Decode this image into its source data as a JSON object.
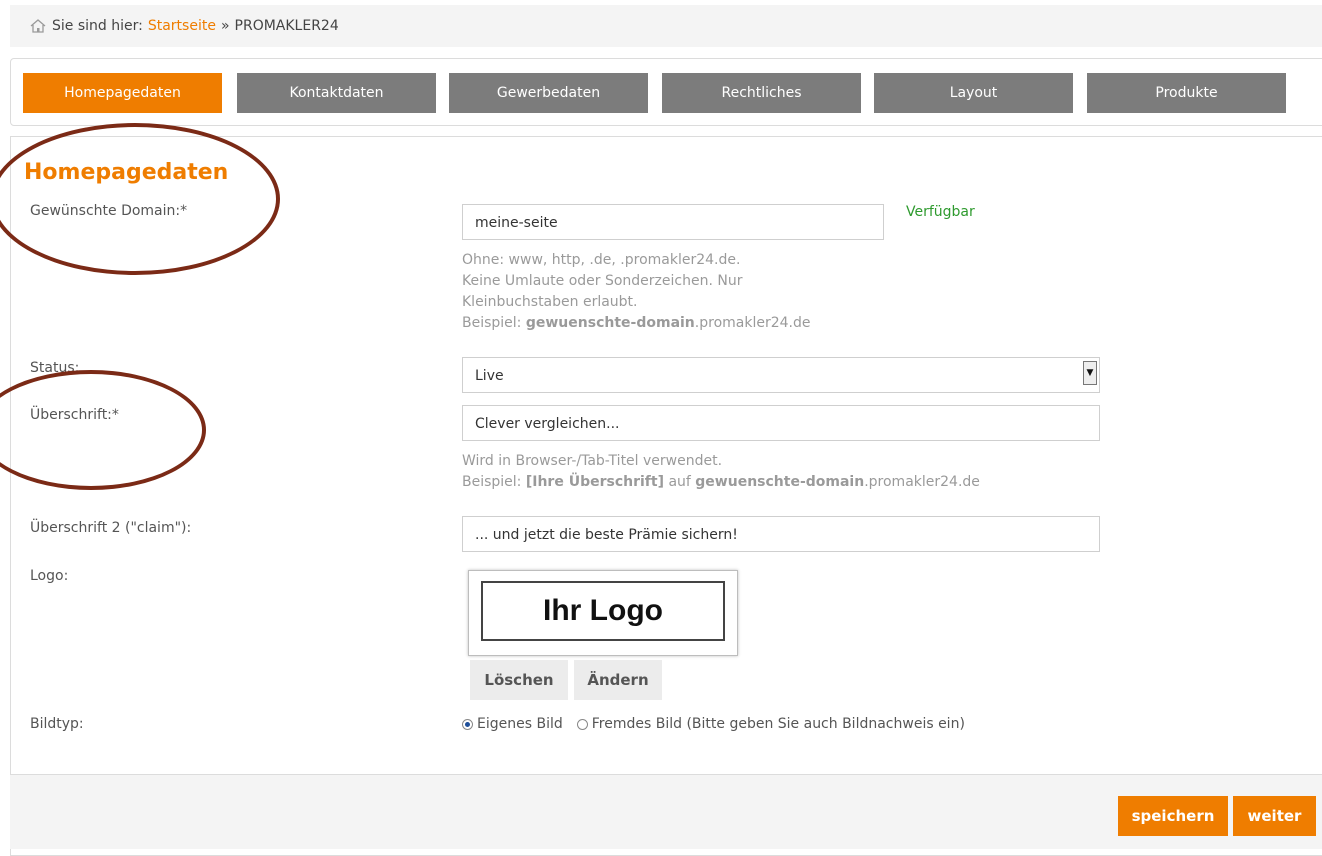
{
  "breadcrumb": {
    "prefix": "Sie sind hier:",
    "home_link": "Startseite",
    "separator": "»",
    "current": "PROMAKLER24"
  },
  "tabs": [
    {
      "label": "Homepagedaten",
      "active": true
    },
    {
      "label": "Kontaktdaten",
      "active": false
    },
    {
      "label": "Gewerbedaten",
      "active": false
    },
    {
      "label": "Rechtliches",
      "active": false
    },
    {
      "label": "Layout",
      "active": false
    },
    {
      "label": "Produkte",
      "active": false
    }
  ],
  "section_title": "Homepagedaten",
  "domain": {
    "label": "Gewünschte Domain:*",
    "value": "meine-seite",
    "availability": "Verfügbar",
    "hint_lines": [
      "Ohne: www, http, .de, .promakler24.de.",
      "Keine Umlaute oder Sonderzeichen. Nur",
      "Kleinbuchstaben erlaubt."
    ],
    "example_prefix": "Beispiel:",
    "example_bold": "gewuenschte-domain",
    "example_suffix": ".promakler24.de"
  },
  "status": {
    "label": "Status:",
    "value": "Live"
  },
  "heading": {
    "label": "Überschrift:*",
    "value": "Clever vergleichen...",
    "hint_line": "Wird in Browser-/Tab-Titel verwendet.",
    "example_prefix": "Beispiel:",
    "example_bold1": "[Ihre Überschrift]",
    "example_mid": "auf",
    "example_bold2": "gewuenschte-domain",
    "example_suffix": ".promakler24.de"
  },
  "heading2": {
    "label": "Überschrift 2 (\"claim\"):",
    "value": "... und jetzt die beste Prämie sichern!"
  },
  "logo": {
    "label": "Logo:",
    "placeholder_text": "Ihr Logo",
    "delete_label": "Löschen",
    "change_label": "Ändern"
  },
  "image_type": {
    "label": "Bildtyp:",
    "option1": "Eigenes Bild",
    "option2": "Fremdes Bild (Bitte geben Sie auch Bildnachweis ein)",
    "selected": "Eigenes Bild"
  },
  "actions": {
    "save_label": "speichern",
    "next_label": "weiter"
  },
  "colors": {
    "accent": "#ef7d00",
    "tab_inactive": "#7c7c7c",
    "available": "#2e9a2e",
    "annotation": "#7b2a16"
  }
}
